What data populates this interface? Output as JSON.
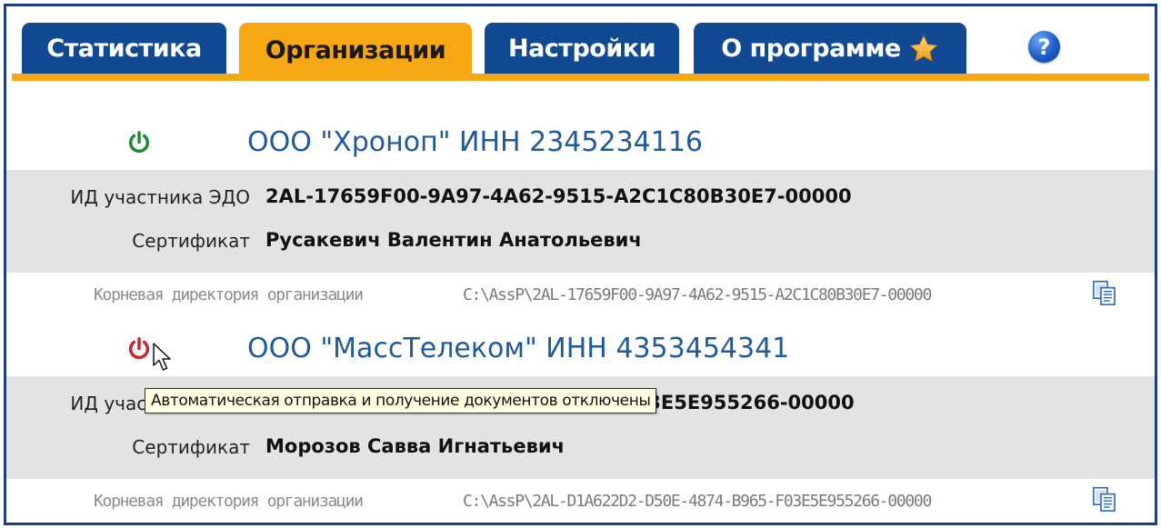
{
  "tabs": [
    {
      "label": "Статистика",
      "active": false
    },
    {
      "label": "Организации",
      "active": true
    },
    {
      "label": "Настройки",
      "active": false
    },
    {
      "label": "О программе",
      "active": false,
      "icon": "star-icon"
    }
  ],
  "help": {
    "label": "?"
  },
  "colors": {
    "tab_blue": "#114a93",
    "tab_orange": "#f5a714",
    "org_name": "#1f5a9c",
    "power_on": "#1e8a34",
    "power_off": "#c2282e",
    "details_bg": "#e3e3e3",
    "tooltip_bg": "#ffffe1"
  },
  "organizations": [
    {
      "name": "ООО \"Хроноп\" ИНН 2345234116",
      "power_state": "on",
      "edo_label": "ИД участника ЭДО",
      "edo_value": "2AL-17659F00-9A97-4A62-9515-A2C1C80B30E7-00000",
      "cert_label": "Сертификат",
      "cert_value": "Русакевич Валентин Анатольевич",
      "root_label": "Корневая директория организации",
      "root_path": "C:\\AssP\\2AL-17659F00-9A97-4A62-9515-A2C1C80B30E7-00000"
    },
    {
      "name": "ООО \"МассТелеком\" ИНН 4353454341",
      "power_state": "off",
      "edo_label": "ИД участника ЭДО",
      "edo_value": "2AL-D1A622D2-D50E-4874-B965-F03E5E955266-00000",
      "cert_label": "Сертификат",
      "cert_value": "Морозов Савва Игнатьевич",
      "root_label": "Корневая директория организации",
      "root_path": "C:\\AssP\\2AL-D1A622D2-D50E-4874-B965-F03E5E955266-00000"
    }
  ],
  "tooltip": "Автоматическая отправка и получение документов отключены"
}
